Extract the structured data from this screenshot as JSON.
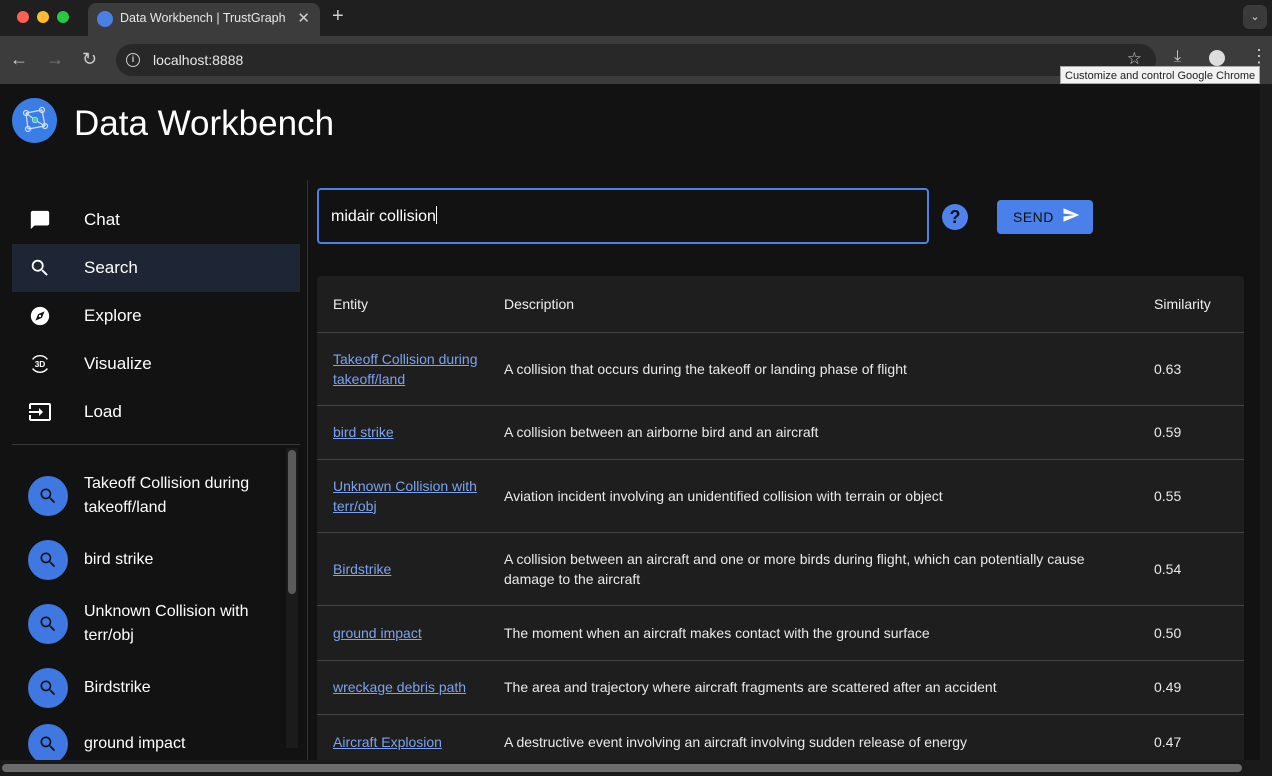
{
  "browser": {
    "tab_title": "Data Workbench | TrustGraph",
    "url": "localhost:8888",
    "tooltip": "Customize and control Google Chrome"
  },
  "app": {
    "title": "Data Workbench"
  },
  "sidebar": {
    "items": [
      {
        "label": "Chat",
        "icon": "chat-icon"
      },
      {
        "label": "Search",
        "icon": "search-icon"
      },
      {
        "label": "Explore",
        "icon": "compass-icon"
      },
      {
        "label": "Visualize",
        "icon": "3d-rotation-icon"
      },
      {
        "label": "Load",
        "icon": "input-icon"
      }
    ],
    "active": "Search"
  },
  "history": {
    "items": [
      {
        "label": "Takeoff Collision during takeoff/land"
      },
      {
        "label": "bird strike"
      },
      {
        "label": "Unknown Collision with terr/obj"
      },
      {
        "label": "Birdstrike"
      },
      {
        "label": "ground impact"
      }
    ]
  },
  "search": {
    "value": "midair collision",
    "send_label": "SEND"
  },
  "results": {
    "headers": {
      "entity": "Entity",
      "description": "Description",
      "similarity": "Similarity"
    },
    "rows": [
      {
        "entity": "Takeoff Collision during takeoff/land",
        "description": "A collision that occurs during the takeoff or landing phase of flight",
        "similarity": "0.63"
      },
      {
        "entity": "bird strike",
        "description": "A collision between an airborne bird and an aircraft",
        "similarity": "0.59"
      },
      {
        "entity": "Unknown Collision with terr/obj",
        "description": "Aviation incident involving an unidentified collision with terrain or object",
        "similarity": "0.55"
      },
      {
        "entity": "Birdstrike",
        "description": "A collision between an aircraft and one or more birds during flight, which can potentially cause damage to the aircraft",
        "similarity": "0.54"
      },
      {
        "entity": "ground impact",
        "description": "The moment when an aircraft makes contact with the ground surface",
        "similarity": "0.50"
      },
      {
        "entity": "wreckage debris path",
        "description": "The area and trajectory where aircraft fragments are scattered after an accident",
        "similarity": "0.49"
      },
      {
        "entity": "Aircraft Explosion",
        "description": "A destructive event involving an aircraft involving sudden release of energy",
        "similarity": "0.47"
      }
    ]
  },
  "colors": {
    "accent": "#4a80ea",
    "link": "#7ba3f0",
    "background": "#121212"
  }
}
